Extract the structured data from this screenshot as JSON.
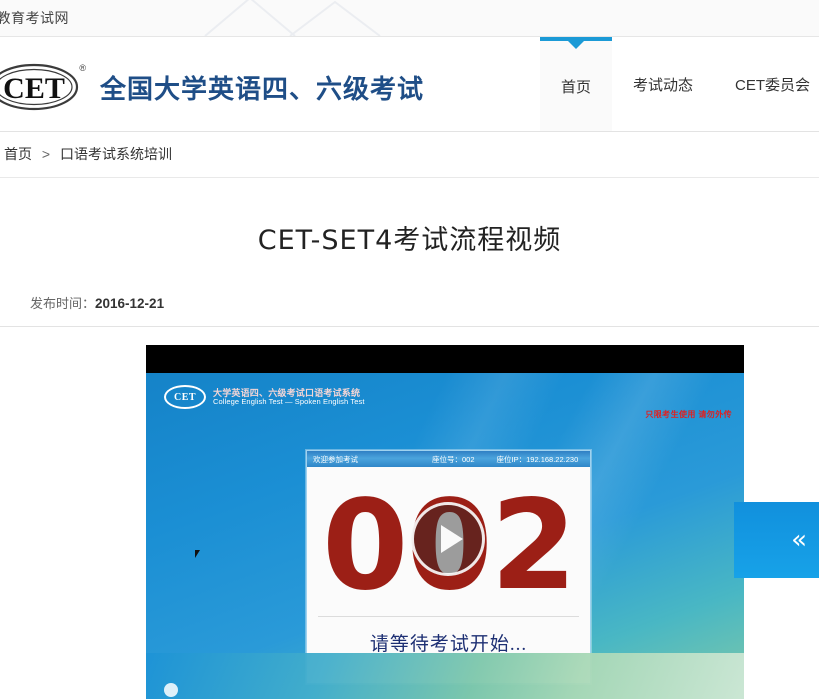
{
  "topbar": {
    "site_name": "国教育考试网"
  },
  "header": {
    "logo_text": "CET",
    "logo_reg": "®",
    "brand_name": "全国大学英语四、六级考试",
    "nav": [
      {
        "label": "首页",
        "active": true
      },
      {
        "label": "考试动态",
        "active": false
      },
      {
        "label": "CET委员会",
        "active": false
      }
    ]
  },
  "breadcrumb": {
    "home": "首页",
    "separator": ">",
    "current": "口语考试系统培训"
  },
  "article": {
    "title": "CET-SET4考试流程视频",
    "meta_label": "发布时间：",
    "meta_value": "2016-12-21"
  },
  "video": {
    "logo_abbr": "CET",
    "logo_cn": "大学英语四、六级考试口语考试系统",
    "logo_en": "College English Test — Spoken English Test",
    "topright_notice": "只限考生使用 请勿外传",
    "dialog": {
      "title": "欢迎参加考试",
      "seat_label": "座位号：",
      "seat_value": "002",
      "ip_label": "座位IP：",
      "ip_value": "192.168.22.230",
      "seat_number": "002",
      "wait_text": "请等待考试开始..."
    },
    "play_icon": "play-triangle"
  },
  "side_panel": {
    "collapse_icon": "«"
  },
  "colors": {
    "accent_blue": "#1b9ad6",
    "brand_blue": "#1f4e87",
    "number_red": "#9c1f16",
    "wait_blue": "#1d2f73",
    "notice_red": "#e02020"
  }
}
